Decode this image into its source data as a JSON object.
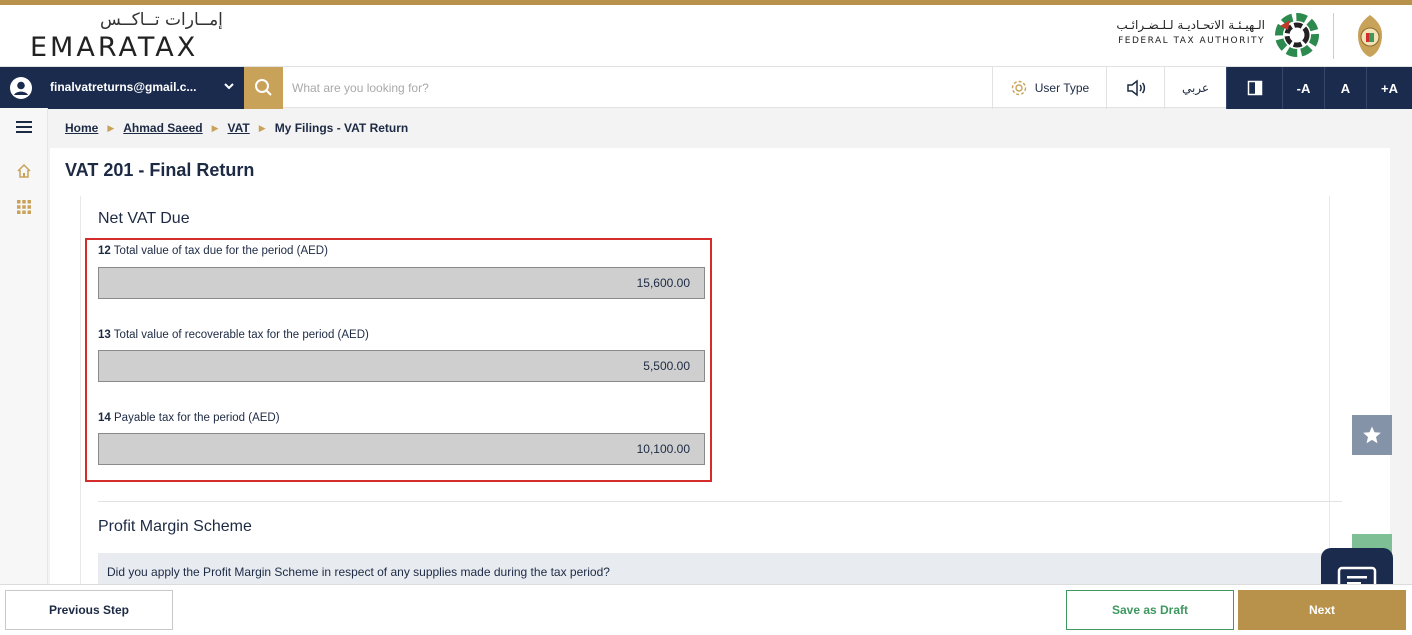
{
  "header": {
    "logo_ar": "إمــارات تــاكــس",
    "logo_en": "EMARATAX",
    "fta_ar": "الـهيـئـة الاتحـاديـة لـلـضـرائـب",
    "fta_en": "FEDERAL TAX AUTHORITY"
  },
  "navbar": {
    "user_email": "finalvatreturns@gmail.c...",
    "search_placeholder": "What are you looking for?",
    "user_type_label": "User Type",
    "language_label": "عربي",
    "font_decrease": "-A",
    "font_normal": "A",
    "font_increase": "+A"
  },
  "breadcrumb": {
    "items": [
      "Home",
      "Ahmad Saeed",
      "VAT"
    ],
    "current": "My Filings - VAT Return"
  },
  "page": {
    "title": "VAT 201 - Final Return"
  },
  "net_vat_due": {
    "title": "Net VAT Due",
    "fields": [
      {
        "number": "12",
        "label": "Total value of tax due for the period (AED)",
        "value": "15,600.00"
      },
      {
        "number": "13",
        "label": "Total value of recoverable tax for the period (AED)",
        "value": "5,500.00"
      },
      {
        "number": "14",
        "label": "Payable tax for the period (AED)",
        "value": "10,100.00"
      }
    ]
  },
  "profit_margin": {
    "title": "Profit Margin Scheme",
    "question": "Did you apply the Profit Margin Scheme in respect of any supplies made during the tax period?"
  },
  "footer": {
    "previous_label": "Previous Step",
    "draft_label": "Save as Draft",
    "next_label": "Next"
  },
  "colors": {
    "navy": "#1a2b4d",
    "gold": "#b8924a",
    "green": "#3e9860",
    "highlight_red": "#d42b2b"
  }
}
